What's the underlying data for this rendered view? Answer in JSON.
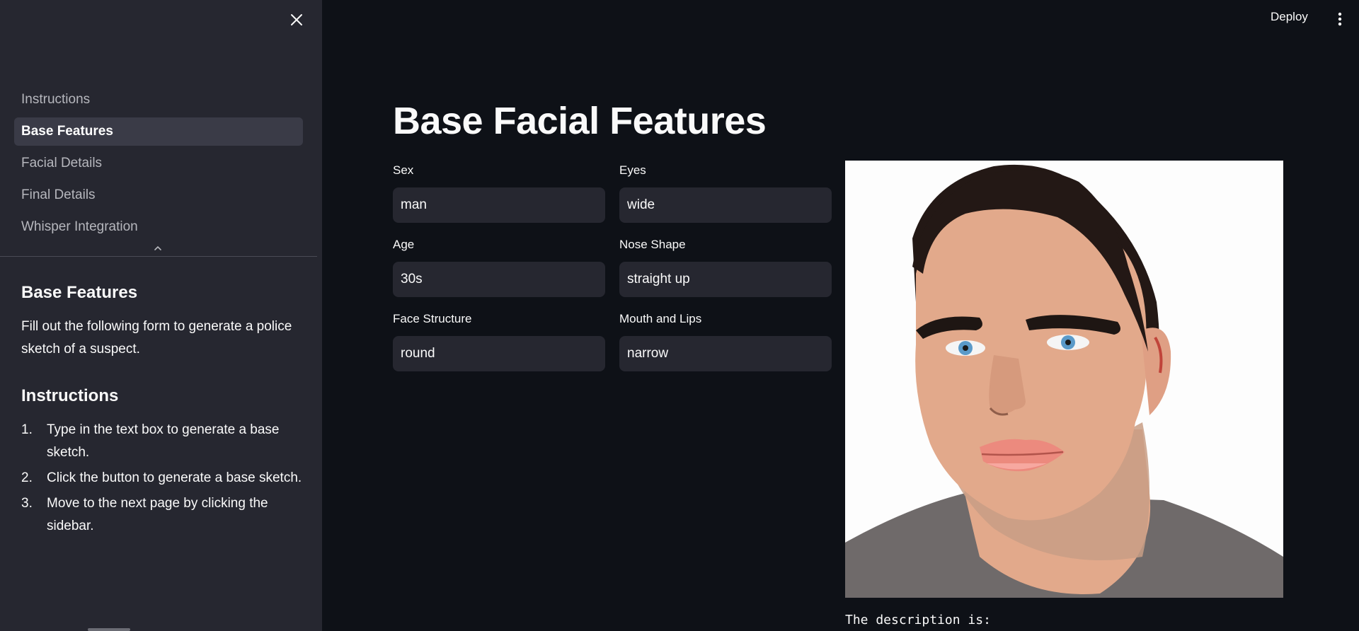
{
  "header": {
    "deploy_label": "Deploy",
    "menu_icon": "kebab-menu-icon"
  },
  "sidebar": {
    "close_icon": "close-icon",
    "nav": [
      {
        "label": "Instructions",
        "active": false
      },
      {
        "label": "Base Features",
        "active": true
      },
      {
        "label": "Facial Details",
        "active": false
      },
      {
        "label": "Final Details",
        "active": false
      },
      {
        "label": "Whisper Integration",
        "active": false
      }
    ],
    "collapse_icon": "chevron-up-icon",
    "section_title": "Base Features",
    "section_text": "Fill out the following form to generate a police sketch of a suspect.",
    "instructions_title": "Instructions",
    "instructions": [
      {
        "num": "1.",
        "text": "Type in the text box to generate a base sketch."
      },
      {
        "num": "2.",
        "text": "Click the button to generate a base sketch."
      },
      {
        "num": "3.",
        "text": "Move to the next page by clicking the sidebar."
      }
    ]
  },
  "main": {
    "title": "Base Facial Features",
    "fields": {
      "sex": {
        "label": "Sex",
        "value": "man"
      },
      "eyes": {
        "label": "Eyes",
        "value": "wide"
      },
      "age": {
        "label": "Age",
        "value": "30s"
      },
      "nose": {
        "label": "Nose Shape",
        "value": "straight up"
      },
      "face": {
        "label": "Face Structure",
        "value": "round"
      },
      "mouth": {
        "label": "Mouth and Lips",
        "value": "narrow"
      }
    },
    "description_label": "The description is:"
  },
  "colors": {
    "background": "#0e1117",
    "sidebar": "#262730",
    "input": "#262730",
    "nav_active": "#3a3b47",
    "text": "#fafafa",
    "skin": "#e2a98b",
    "hair": "#231815",
    "shirt": "#6f6a6a"
  }
}
